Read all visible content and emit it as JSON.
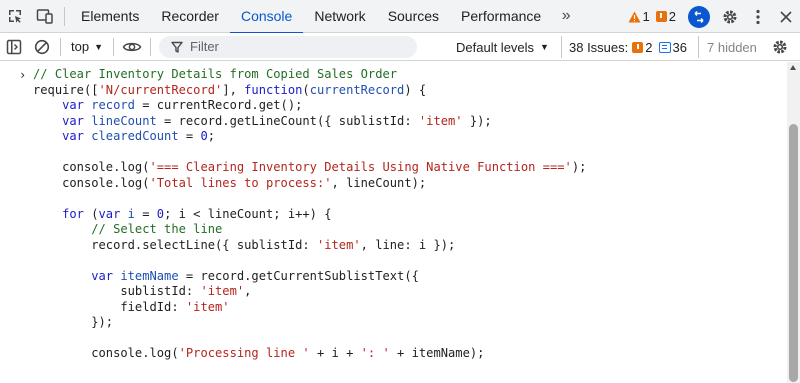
{
  "tabs": [
    {
      "label": "Elements"
    },
    {
      "label": "Recorder"
    },
    {
      "label": "Console"
    },
    {
      "label": "Network"
    },
    {
      "label": "Sources"
    },
    {
      "label": "Performance"
    }
  ],
  "active_tab": "Console",
  "more_tabs": "»",
  "counters": {
    "warnings": "1",
    "issues": "2"
  },
  "toolbar": {
    "context": "top",
    "filter_placeholder": "Filter",
    "levels": "Default levels",
    "issues_label": "38 Issues:",
    "issues_warn": "2",
    "issues_info": "36",
    "hidden": "7 hidden"
  },
  "colors": {
    "accent": "#0b57d0",
    "comment": "#236e25",
    "keyword": "#1b1bc9",
    "string": "#b3261e",
    "warning": "#e8710a"
  },
  "console": {
    "prompt": "›",
    "lines": [
      [
        {
          "t": "c",
          "x": "// Clear Inventory Details from Copied Sales Order"
        }
      ],
      [
        {
          "t": "p",
          "x": "require(["
        },
        {
          "t": "s",
          "x": "'N/currentRecord'"
        },
        {
          "t": "p",
          "x": "], "
        },
        {
          "t": "k",
          "x": "function"
        },
        {
          "t": "p",
          "x": "("
        },
        {
          "t": "v",
          "x": "currentRecord"
        },
        {
          "t": "p",
          "x": ") {"
        }
      ],
      [
        {
          "t": "p",
          "x": "    "
        },
        {
          "t": "k",
          "x": "var"
        },
        {
          "t": "p",
          "x": " "
        },
        {
          "t": "v",
          "x": "record"
        },
        {
          "t": "p",
          "x": " = currentRecord.get();"
        }
      ],
      [
        {
          "t": "p",
          "x": "    "
        },
        {
          "t": "k",
          "x": "var"
        },
        {
          "t": "p",
          "x": " "
        },
        {
          "t": "v",
          "x": "lineCount"
        },
        {
          "t": "p",
          "x": " = record.getLineCount({ sublistId: "
        },
        {
          "t": "s",
          "x": "'item'"
        },
        {
          "t": "p",
          "x": " });"
        }
      ],
      [
        {
          "t": "p",
          "x": "    "
        },
        {
          "t": "k",
          "x": "var"
        },
        {
          "t": "p",
          "x": " "
        },
        {
          "t": "v",
          "x": "clearedCount"
        },
        {
          "t": "p",
          "x": " = "
        },
        {
          "t": "n",
          "x": "0"
        },
        {
          "t": "p",
          "x": ";"
        }
      ],
      [
        {
          "t": "p",
          "x": ""
        }
      ],
      [
        {
          "t": "p",
          "x": "    console.log("
        },
        {
          "t": "s",
          "x": "'=== Clearing Inventory Details Using Native Function ==='"
        },
        {
          "t": "p",
          "x": ");"
        }
      ],
      [
        {
          "t": "p",
          "x": "    console.log("
        },
        {
          "t": "s",
          "x": "'Total lines to process:'"
        },
        {
          "t": "p",
          "x": ", lineCount);"
        }
      ],
      [
        {
          "t": "p",
          "x": ""
        }
      ],
      [
        {
          "t": "p",
          "x": "    "
        },
        {
          "t": "k",
          "x": "for"
        },
        {
          "t": "p",
          "x": " ("
        },
        {
          "t": "k",
          "x": "var"
        },
        {
          "t": "p",
          "x": " "
        },
        {
          "t": "v",
          "x": "i"
        },
        {
          "t": "p",
          "x": " = "
        },
        {
          "t": "n",
          "x": "0"
        },
        {
          "t": "p",
          "x": "; i < lineCount; i++) {"
        }
      ],
      [
        {
          "t": "p",
          "x": "        "
        },
        {
          "t": "c",
          "x": "// Select the line"
        }
      ],
      [
        {
          "t": "p",
          "x": "        record.selectLine({ sublistId: "
        },
        {
          "t": "s",
          "x": "'item'"
        },
        {
          "t": "p",
          "x": ", line: i });"
        }
      ],
      [
        {
          "t": "p",
          "x": ""
        }
      ],
      [
        {
          "t": "p",
          "x": "        "
        },
        {
          "t": "k",
          "x": "var"
        },
        {
          "t": "p",
          "x": " "
        },
        {
          "t": "v",
          "x": "itemName"
        },
        {
          "t": "p",
          "x": " = record.getCurrentSublistText({"
        }
      ],
      [
        {
          "t": "p",
          "x": "            sublistId: "
        },
        {
          "t": "s",
          "x": "'item'"
        },
        {
          "t": "p",
          "x": ","
        }
      ],
      [
        {
          "t": "p",
          "x": "            fieldId: "
        },
        {
          "t": "s",
          "x": "'item'"
        }
      ],
      [
        {
          "t": "p",
          "x": "        });"
        }
      ],
      [
        {
          "t": "p",
          "x": ""
        }
      ],
      [
        {
          "t": "p",
          "x": "        console.log("
        },
        {
          "t": "s",
          "x": "'Processing line '"
        },
        {
          "t": "p",
          "x": " + i + "
        },
        {
          "t": "s",
          "x": "': '"
        },
        {
          "t": "p",
          "x": " + itemName);"
        }
      ]
    ]
  }
}
